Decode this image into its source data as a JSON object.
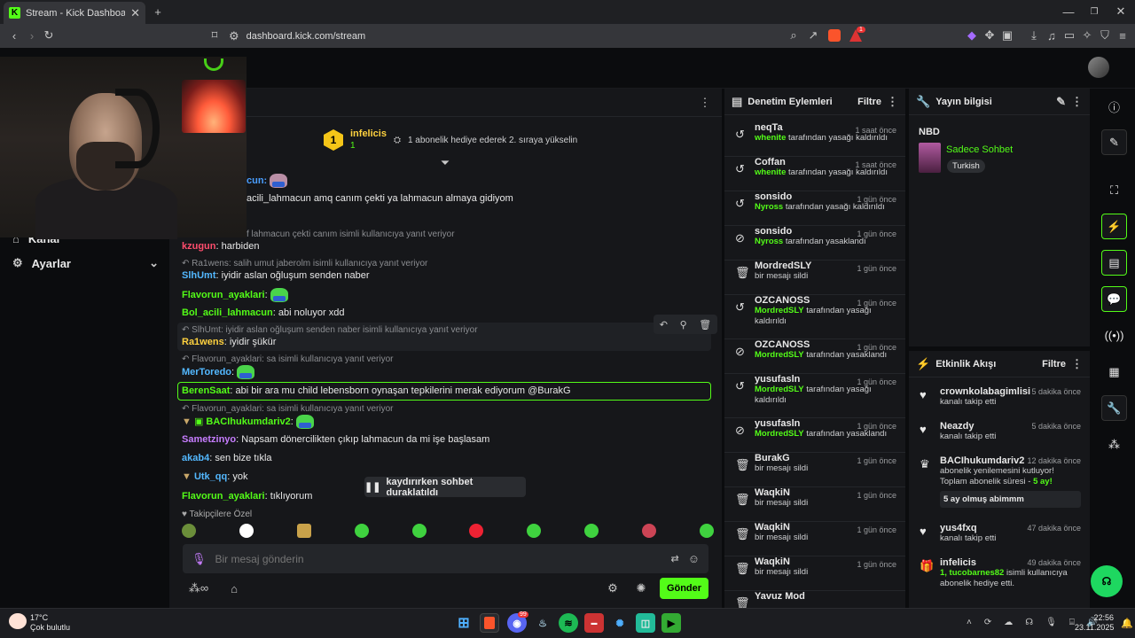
{
  "browser": {
    "tab_title": "Stream - Kick Dashboard",
    "favicon": "K",
    "url": "dashboard.kick.com/stream",
    "ext_badge": "1"
  },
  "sidebar": {
    "items": [
      {
        "label": "Kanal",
        "icon": "home-icon"
      },
      {
        "label": "Ayarlar",
        "icon": "gear-icon"
      }
    ]
  },
  "chat": {
    "pinned": {
      "badge": "1",
      "user": "infelicis",
      "count": "1",
      "text": "1 abonelik hediye ederek 2. sıraya yükselin"
    },
    "messages": [
      {
        "reply": "",
        "user": "cun:",
        "color": "#4a9eff",
        "text": ""
      },
      {
        "reply": "",
        "user": "",
        "color": "#e8e8e8",
        "text": "acili_lahmacun amq canım çekti ya lahmacun almaya gidiyom"
      },
      {
        "reply": "f lahmacun çekti canım isimli kullanıcıya yanıt veriyor",
        "user": "",
        "color": "",
        "text": ""
      },
      {
        "reply": "",
        "user": "kzugun",
        "color": "#ff4d6d",
        "text": "harbiden"
      },
      {
        "reply": "Ra1wens: salih umut jaberolm isimli kullanıcıya yanıt veriyor",
        "user": "",
        "color": "",
        "text": ""
      },
      {
        "reply": "",
        "user": "SlhUmt",
        "color": "#53b8ff",
        "text": "iyidir aslan oğluşum senden naber"
      },
      {
        "reply": "",
        "user": "Flavorun_ayaklari",
        "color": "#53fc18",
        "text": ""
      },
      {
        "reply": "",
        "user": "Bol_acili_lahmacun",
        "color": "#53fc18",
        "text": "abi noluyor xdd"
      },
      {
        "reply": "SlhUmt: iyidir aslan oğluşum senden naber isimli kullanıcıya yanıt veriyor",
        "user": "",
        "color": "",
        "text": ""
      },
      {
        "reply": "",
        "user": "Ra1wens",
        "color": "#ffd23f",
        "text": "iyidir şükür"
      },
      {
        "reply": "Flavorun_ayaklari: sa isimli kullanıcıya yanıt veriyor",
        "user": "",
        "color": "",
        "text": ""
      },
      {
        "reply": "",
        "user": "MerToredo",
        "color": "#53b8ff",
        "text": ""
      },
      {
        "reply": "",
        "user": "BerenSaat",
        "color": "#53fc18",
        "text": "abi bir ara mu child lebensborn oynaşan tepkilerini merak ediyorum @BurakG"
      },
      {
        "reply": "Flavorun_ayaklari: sa isimli kullanıcıya yanıt veriyor",
        "user": "",
        "color": "",
        "text": ""
      },
      {
        "reply": "",
        "user": "BACIhukumdariv2",
        "color": "#53fc18",
        "text": ""
      },
      {
        "reply": "",
        "user": "Sametzinyo",
        "color": "#c77dff",
        "text": "Napsam dönercilikten çıkıp lahmacun da mi işe başlasam"
      },
      {
        "reply": "",
        "user": "akab4",
        "color": "#53b8ff",
        "text": "sen bize tıkla"
      },
      {
        "reply": "",
        "user": "Utk_qq",
        "color": "#53b8ff",
        "text": "yok"
      },
      {
        "reply": "",
        "user": "Flavorun_ayaklari",
        "color": "#53fc18",
        "text": "tıklıyorum"
      }
    ],
    "paused_label": "kaydırırken sohbet duraklatıldı",
    "followers_only": "Takipçilere Özel",
    "input_placeholder": "Bir mesaj gönderin",
    "send_label": "Gönder"
  },
  "mod_panel": {
    "title": "Denetim Eylemleri",
    "filter": "Filtre",
    "items": [
      {
        "icon": "unban-icon",
        "user": "neqTa",
        "time": "1 saat önce",
        "actor": "whenite",
        "action": "tarafından yasağı kaldırıldı"
      },
      {
        "icon": "unban-icon",
        "user": "Coffan",
        "time": "1 saat önce",
        "actor": "whenite",
        "action": "tarafından yasağı kaldırıldı"
      },
      {
        "icon": "unban-icon",
        "user": "sonsido",
        "time": "1 gün önce",
        "actor": "Nyross",
        "action": "tarafından yasağı kaldırıldı"
      },
      {
        "icon": "ban-icon",
        "user": "sonsido",
        "time": "1 gün önce",
        "actor": "Nyross",
        "action": "tarafından yasaklandı"
      },
      {
        "icon": "trash-icon",
        "user": "MordredSLY",
        "time": "1 gün önce",
        "actor": "",
        "action": "bir mesajı sildi"
      },
      {
        "icon": "unban-icon",
        "user": "OZCANOSS",
        "time": "1 gün önce",
        "actor": "MordredSLY",
        "action": "tarafından yasağı kaldırıldı"
      },
      {
        "icon": "ban-icon",
        "user": "OZCANOSS",
        "time": "1 gün önce",
        "actor": "MordredSLY",
        "action": "tarafından yasaklandı"
      },
      {
        "icon": "unban-icon",
        "user": "yusufasln",
        "time": "1 gün önce",
        "actor": "MordredSLY",
        "action": "tarafından yasağı kaldırıldı"
      },
      {
        "icon": "ban-icon",
        "user": "yusufasln",
        "time": "1 gün önce",
        "actor": "MordredSLY",
        "action": "tarafından yasaklandı"
      },
      {
        "icon": "trash-icon",
        "user": "BurakG",
        "time": "1 gün önce",
        "actor": "",
        "action": "bir mesajı sildi"
      },
      {
        "icon": "trash-icon",
        "user": "WaqkiN",
        "time": "1 gün önce",
        "actor": "",
        "action": "bir mesajı sildi"
      },
      {
        "icon": "trash-icon",
        "user": "WaqkiN",
        "time": "1 gün önce",
        "actor": "",
        "action": "bir mesajı sildi"
      },
      {
        "icon": "trash-icon",
        "user": "WaqkiN",
        "time": "1 gün önce",
        "actor": "",
        "action": "bir mesajı sildi"
      },
      {
        "icon": "trash-icon",
        "user": "Yavuz Mod",
        "time": "",
        "actor": "",
        "action": ""
      }
    ]
  },
  "stream_info": {
    "title": "Yayın bilgisi",
    "stream_title": "NBD",
    "category": "Sadece Sohbet",
    "language": "Turkish"
  },
  "events": {
    "title": "Etkinlik Akışı",
    "filter": "Filtre",
    "items": [
      {
        "icon": "heart-icon",
        "user": "crownkolabagimlisi",
        "time": "5 dakika önce",
        "text": "kanalı takip etti",
        "extra": ""
      },
      {
        "icon": "heart-icon",
        "user": "Neazdy",
        "time": "5 dakika önce",
        "text": "kanalı takip etti",
        "extra": ""
      },
      {
        "icon": "crown-icon",
        "user": "BACIhukumdariv2",
        "time": "12 dakika önce",
        "text": "abonelik yenilemesini kutluyor! Toplam abonelik süresi -",
        "extra": "5 ay!",
        "note": "5 ay olmuş abimmm"
      },
      {
        "icon": "heart-icon",
        "user": "yus4fxq",
        "time": "47 dakika önce",
        "text": "kanalı takip etti",
        "extra": ""
      },
      {
        "icon": "gift-icon",
        "user": "infelicis",
        "time": "49 dakika önce",
        "text": "isimli kullanıcıya abonelik hediye etti.",
        "extra": "1, tucobarnes82"
      }
    ]
  },
  "taskbar": {
    "temp": "17°C",
    "weather": "Çok bulutlu",
    "time": "22:56",
    "date": "23.11.2025",
    "badge": "99"
  },
  "colors": {
    "accent": "#53fc18",
    "panel": "#16171a",
    "bg": "#0b0c0e"
  }
}
